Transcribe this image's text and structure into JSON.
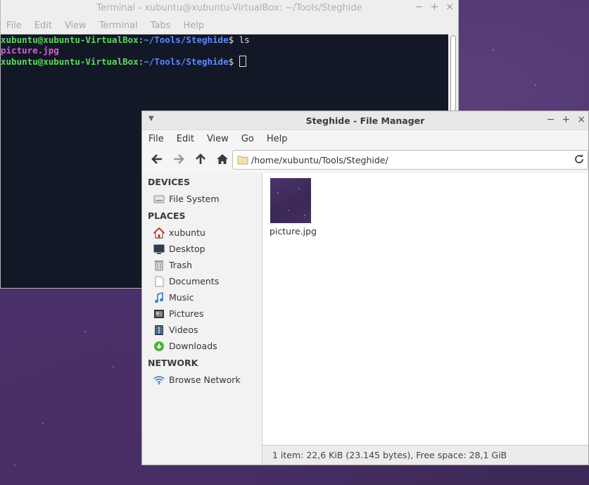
{
  "terminal": {
    "title": "Terminal - xubuntu@xubuntu-VirtualBox: ~/Tools/Steghide",
    "menu": [
      "File",
      "Edit",
      "View",
      "Terminal",
      "Tabs",
      "Help"
    ],
    "prompt_user": "xubuntu@xubuntu-VirtualBox",
    "prompt_sep": ":",
    "prompt_path": "~/Tools/Steghide",
    "prompt_symbol": "$ ",
    "command": "ls",
    "output_file": "picture.jpg"
  },
  "file_manager": {
    "title": "Steghide - File Manager",
    "menu": [
      "File",
      "Edit",
      "View",
      "Go",
      "Help"
    ],
    "address": "/home/xubuntu/Tools/Steghide/",
    "sidebar": {
      "devices_header": "DEVICES",
      "devices": [
        {
          "label": "File System",
          "icon": "drive-icon"
        }
      ],
      "places_header": "PLACES",
      "places": [
        {
          "label": "xubuntu",
          "icon": "home-icon"
        },
        {
          "label": "Desktop",
          "icon": "desktop-icon"
        },
        {
          "label": "Trash",
          "icon": "trash-icon"
        },
        {
          "label": "Documents",
          "icon": "document-icon"
        },
        {
          "label": "Music",
          "icon": "music-icon"
        },
        {
          "label": "Pictures",
          "icon": "pictures-icon"
        },
        {
          "label": "Videos",
          "icon": "video-icon"
        },
        {
          "label": "Downloads",
          "icon": "download-icon"
        }
      ],
      "network_header": "NETWORK",
      "network": [
        {
          "label": "Browse Network",
          "icon": "wifi-icon"
        }
      ]
    },
    "files": [
      {
        "name": "picture.jpg"
      }
    ],
    "status": "1 item: 22,6 KiB (23.145 bytes), Free space: 28,1 GiB"
  },
  "colors": {
    "terminal_bg": "#121826",
    "prompt_user": "#5fd75f",
    "prompt_path": "#5f87ff",
    "file_listing": "#d75fd7"
  }
}
